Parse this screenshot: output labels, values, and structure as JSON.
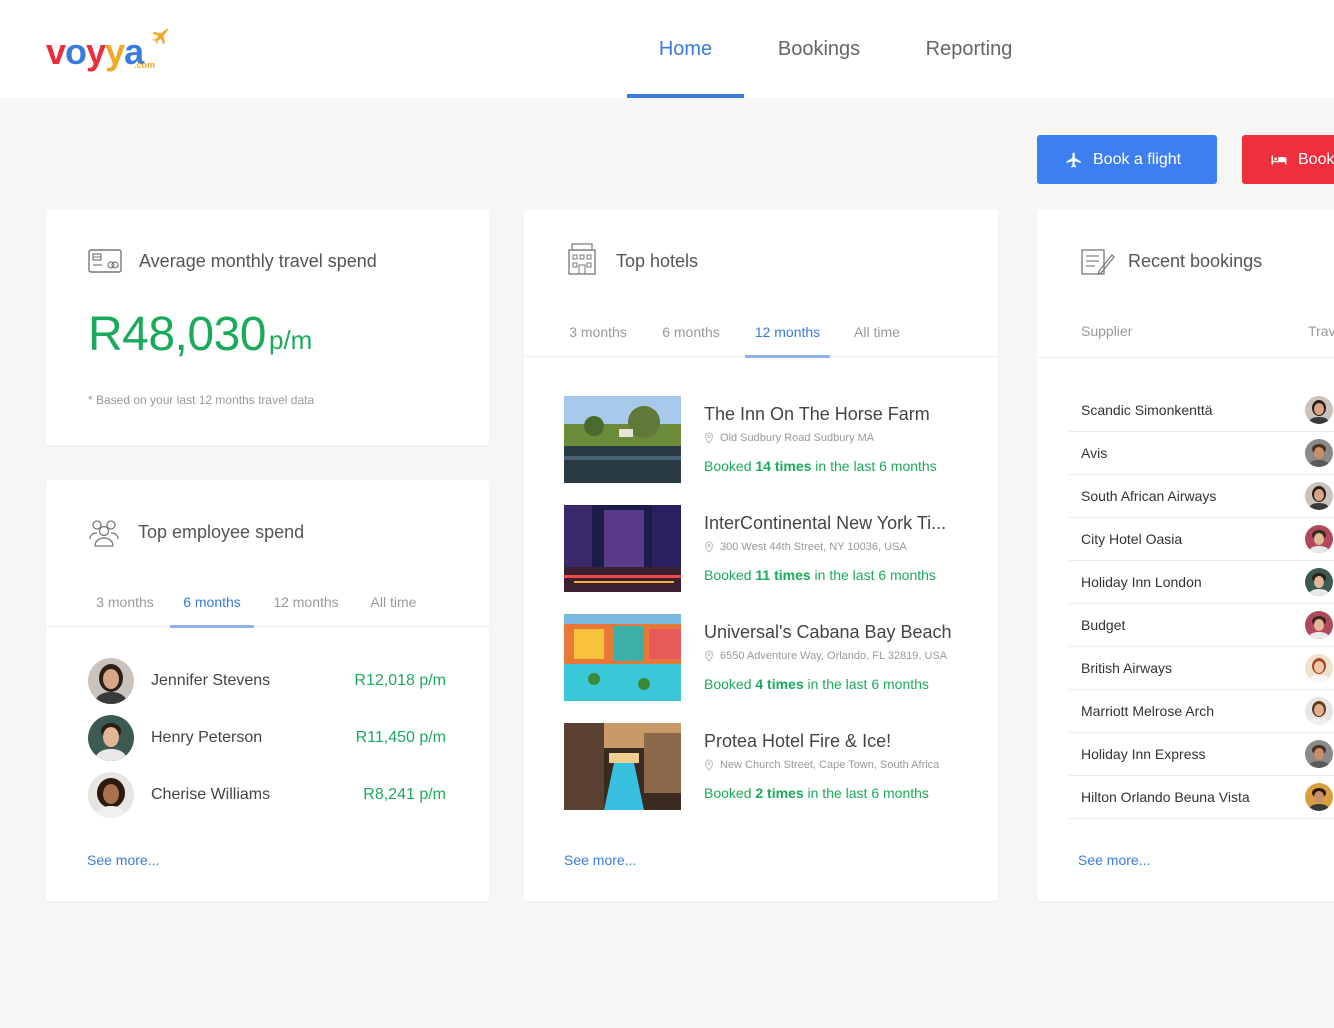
{
  "header": {
    "logo": {
      "word": [
        "v",
        "o",
        "y",
        "y",
        "a"
      ],
      "suffix": ".com"
    },
    "nav": [
      {
        "label": "Home",
        "active": true
      },
      {
        "label": "Bookings",
        "active": false
      },
      {
        "label": "Reporting",
        "active": false
      }
    ]
  },
  "actions": {
    "book_flight": "Book a flight",
    "book_hotel": "Book"
  },
  "spend_card": {
    "title": "Average monthly travel spend",
    "amount": "R48,030",
    "unit": "p/m",
    "note": "* Based on your last 12 months travel data"
  },
  "employee_card": {
    "title": "Top employee spend",
    "tabs": [
      "3 months",
      "6 months",
      "12 months",
      "All time"
    ],
    "active_tab": "6 months",
    "rows": [
      {
        "name": "Jennifer Stevens",
        "spend": "R12,018 p/m"
      },
      {
        "name": "Henry Peterson",
        "spend": "R11,450 p/m"
      },
      {
        "name": "Cherise Williams",
        "spend": "R8,241 p/m"
      }
    ],
    "see_more": "See more..."
  },
  "hotels_card": {
    "title": "Top hotels",
    "tabs": [
      "3 months",
      "6 months",
      "12 months",
      "All time"
    ],
    "active_tab": "12 months",
    "rows": [
      {
        "name": "The Inn On The Horse Farm",
        "address": "Old Sudbury Road Sudbury MA",
        "booked_prefix": "Booked ",
        "times": "14 times",
        "booked_suffix": " in the last 6 months"
      },
      {
        "name": "InterContinental New York Ti...",
        "address": "300 West 44th Street, NY 10036, USA",
        "booked_prefix": "Booked ",
        "times": "11 times",
        "booked_suffix": " in the last 6 months"
      },
      {
        "name": "Universal's Cabana Bay Beach",
        "address": "6550 Adventure Way, Orlando, FL 32819, USA",
        "booked_prefix": "Booked ",
        "times": "4 times",
        "booked_suffix": " in the last 6 months"
      },
      {
        "name": "Protea Hotel Fire & Ice!",
        "address": "New Church Street, Cape Town, South Africa",
        "booked_prefix": "Booked ",
        "times": "2 times",
        "booked_suffix": " in the last 6 months"
      }
    ],
    "see_more": "See more..."
  },
  "recent_card": {
    "title": "Recent bookings",
    "columns": [
      "Supplier",
      "Trav"
    ],
    "rows": [
      {
        "supplier": "Scandic Simonkenttä"
      },
      {
        "supplier": "Avis"
      },
      {
        "supplier": "South African Airways"
      },
      {
        "supplier": "City Hotel Oasia"
      },
      {
        "supplier": "Holiday Inn London"
      },
      {
        "supplier": "Budget"
      },
      {
        "supplier": "British Airways"
      },
      {
        "supplier": "Marriott Melrose Arch"
      },
      {
        "supplier": "Holiday Inn Express"
      },
      {
        "supplier": "Hilton Orlando Beuna Vista"
      }
    ],
    "see_more": "See more..."
  },
  "colors": {
    "primary": "#3a7be0",
    "flight_button": "#3d7ff0",
    "hotel_button": "#ef2f3d",
    "money_green": "#1aaa5c"
  }
}
